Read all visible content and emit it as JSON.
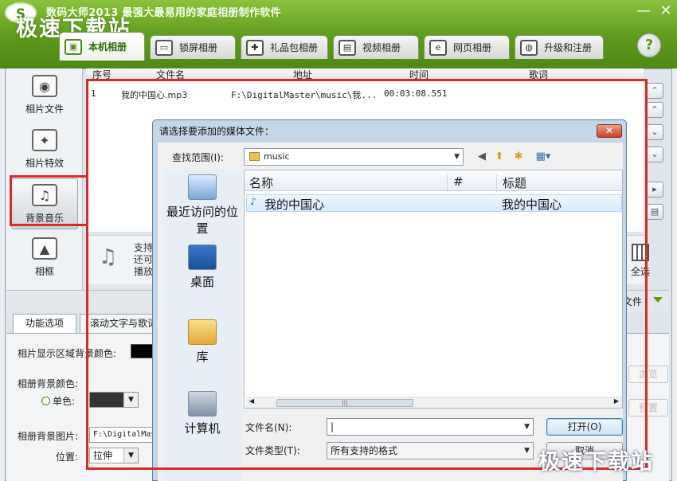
{
  "app": {
    "logo": "S",
    "title": "数码大师2013   最强大最易用的家庭相册制作软件",
    "watermark": "极速下载站",
    "help": "?"
  },
  "window": {
    "minimize": "—",
    "close": "✕"
  },
  "tabs": [
    {
      "label": "本机相册",
      "icon": "photo-album-icon",
      "glyph": "▣"
    },
    {
      "label": "锁屏相册",
      "icon": "monitor-icon",
      "glyph": "▭"
    },
    {
      "label": "礼品包相册",
      "icon": "gift-icon",
      "glyph": "✚"
    },
    {
      "label": "视频相册",
      "icon": "film-icon",
      "glyph": "▤"
    },
    {
      "label": "网页相册",
      "icon": "ie-icon",
      "glyph": "e"
    },
    {
      "label": "升级和注册",
      "icon": "globe-icon",
      "glyph": "◍"
    }
  ],
  "sidebar": {
    "items": [
      {
        "label": "相片文件",
        "icon": "camera-icon",
        "glyph": "◉"
      },
      {
        "label": "相片特效",
        "icon": "effects-icon",
        "glyph": "✦"
      },
      {
        "label": "背景音乐",
        "icon": "music-note-icon",
        "glyph": "♫"
      },
      {
        "label": "相框",
        "icon": "frame-icon",
        "glyph": "▲"
      }
    ]
  },
  "music_list": {
    "columns": [
      "序号",
      "文件名",
      "地址",
      "时间",
      "歌词"
    ],
    "rows": [
      {
        "index": "1",
        "filename": "我的中国心.mp3",
        "path": "F:\\DigitalMaster\\music\\我...",
        "time": "00:03:08.551",
        "lyrics": ""
      }
    ]
  },
  "right_tools": [
    "⌃",
    "⌃",
    "⌄",
    "⌄",
    "▸",
    "▤"
  ],
  "info": {
    "lines": [
      "支持",
      "还可",
      "播放"
    ],
    "select_all": "全选",
    "file_label": "文件"
  },
  "bottom_tabs": [
    "功能选项",
    "滚动文字与歌词"
  ],
  "settings": {
    "bg_color_label": "相片显示区域背景颜色:",
    "album_bg_color_label": "相册背景颜色:",
    "solid_color_label": "单色:",
    "bg_image_label": "相册背景图片:",
    "bg_image_path": "F:\\DigitalMaster",
    "position_label": "位置:",
    "position_value": "拉伸",
    "browse_button": "浏览",
    "preview_button": "预置",
    "colors": {
      "display_bg": "#000000",
      "solid": "#333333"
    }
  },
  "dialog": {
    "title": "请选择要添加的媒体文件：",
    "close": "✕",
    "look_in_label": "查找范围(I):",
    "look_in_value": "music",
    "nav_icons": [
      "back-icon",
      "up-folder-icon",
      "new-folder-icon",
      "view-menu-icon"
    ],
    "places": [
      "最近访问的位置",
      "桌面",
      "库",
      "计算机"
    ],
    "columns": [
      "名称",
      "#",
      "标题"
    ],
    "files": [
      {
        "name": "我的中国心",
        "number": "",
        "title": "我的中国心"
      }
    ],
    "filename_label": "文件名(N):",
    "filename_value": "|",
    "filetype_label": "文件类型(T):",
    "filetype_value": "所有支持的格式",
    "open_button": "打开(O)",
    "cancel_button": "取消"
  }
}
